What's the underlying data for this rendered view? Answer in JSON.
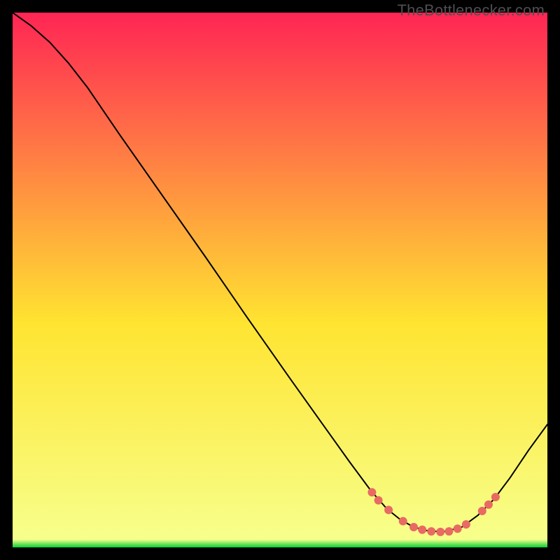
{
  "watermark": "TheBottlenecker.com",
  "chart_data": {
    "type": "line",
    "title": "",
    "xlabel": "",
    "ylabel": "",
    "xlim": [
      0,
      100
    ],
    "ylim": [
      0,
      100
    ],
    "grid": false,
    "background_gradient": {
      "top": "#ff2554",
      "mid": "#ffe431",
      "bottom": "#06d035"
    },
    "series": [
      {
        "name": "curve",
        "color": "#000000",
        "stroke_width": 2,
        "points": [
          {
            "x": 0.0,
            "y": 100.0
          },
          {
            "x": 3.5,
            "y": 97.5
          },
          {
            "x": 7.0,
            "y": 94.4
          },
          {
            "x": 10.5,
            "y": 90.5
          },
          {
            "x": 14.0,
            "y": 86.0
          },
          {
            "x": 20.0,
            "y": 77.2
          },
          {
            "x": 28.0,
            "y": 65.8
          },
          {
            "x": 36.0,
            "y": 54.4
          },
          {
            "x": 44.0,
            "y": 42.8
          },
          {
            "x": 52.0,
            "y": 31.4
          },
          {
            "x": 58.0,
            "y": 23.0
          },
          {
            "x": 63.0,
            "y": 16.0
          },
          {
            "x": 67.0,
            "y": 10.6
          },
          {
            "x": 70.0,
            "y": 7.2
          },
          {
            "x": 72.5,
            "y": 5.2
          },
          {
            "x": 75.0,
            "y": 3.8
          },
          {
            "x": 78.0,
            "y": 3.0
          },
          {
            "x": 81.0,
            "y": 3.0
          },
          {
            "x": 84.0,
            "y": 3.8
          },
          {
            "x": 87.0,
            "y": 6.0
          },
          {
            "x": 90.0,
            "y": 9.0
          },
          {
            "x": 93.0,
            "y": 13.0
          },
          {
            "x": 96.5,
            "y": 18.2
          },
          {
            "x": 100.0,
            "y": 23.0
          }
        ]
      }
    ],
    "markers": {
      "color": "#e86a62",
      "radius": 6,
      "points": [
        {
          "x": 67.2,
          "y": 10.3
        },
        {
          "x": 68.4,
          "y": 8.8
        },
        {
          "x": 70.3,
          "y": 7.0
        },
        {
          "x": 73.0,
          "y": 4.9
        },
        {
          "x": 75.0,
          "y": 3.8
        },
        {
          "x": 76.6,
          "y": 3.3
        },
        {
          "x": 78.3,
          "y": 3.0
        },
        {
          "x": 80.0,
          "y": 2.9
        },
        {
          "x": 81.6,
          "y": 3.0
        },
        {
          "x": 83.2,
          "y": 3.5
        },
        {
          "x": 84.8,
          "y": 4.3
        },
        {
          "x": 87.8,
          "y": 6.8
        },
        {
          "x": 89.0,
          "y": 8.0
        },
        {
          "x": 90.3,
          "y": 9.4
        }
      ]
    }
  }
}
